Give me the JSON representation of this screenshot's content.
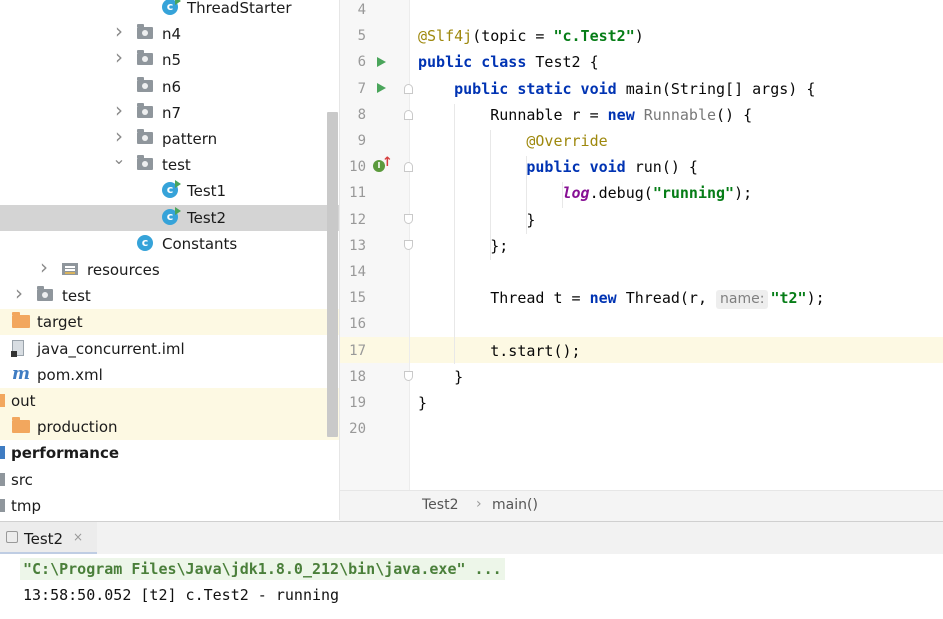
{
  "project_tree": [
    {
      "label": "ThreadStarter",
      "icon": "java-class-runnable-icon",
      "indent": 165,
      "chevron": "none",
      "style": "normal"
    },
    {
      "label": "n4",
      "icon": "package-folder-icon",
      "indent": 140,
      "chevron": "right",
      "style": "normal"
    },
    {
      "label": "n5",
      "icon": "package-folder-icon",
      "indent": 140,
      "chevron": "right",
      "style": "normal"
    },
    {
      "label": "n6",
      "icon": "package-folder-icon",
      "indent": 140,
      "chevron": "none",
      "style": "normal"
    },
    {
      "label": "n7",
      "icon": "package-folder-icon",
      "indent": 140,
      "chevron": "right",
      "style": "normal"
    },
    {
      "label": "pattern",
      "icon": "package-folder-icon",
      "indent": 140,
      "chevron": "right",
      "style": "normal"
    },
    {
      "label": "test",
      "icon": "package-folder-icon",
      "indent": 140,
      "chevron": "down",
      "style": "normal"
    },
    {
      "label": "Test1",
      "icon": "java-class-runnable-icon",
      "indent": 165,
      "chevron": "none",
      "style": "normal"
    },
    {
      "label": "Test2",
      "icon": "java-class-runnable-icon",
      "indent": 165,
      "chevron": "none",
      "style": "selected"
    },
    {
      "label": "Constants",
      "icon": "java-class-icon",
      "indent": 140,
      "chevron": "none",
      "style": "normal"
    },
    {
      "label": "resources",
      "icon": "resources-folder-icon",
      "indent": 65,
      "chevron": "right",
      "style": "normal"
    },
    {
      "label": "test",
      "icon": "folder-icon",
      "indent": 40,
      "chevron": "right",
      "style": "normal"
    },
    {
      "label": "target",
      "icon": "excluded-folder-icon",
      "indent": 15,
      "chevron": "none",
      "style": "excluded"
    },
    {
      "label": "java_concurrent.iml",
      "icon": "iml-file-icon",
      "indent": 15,
      "chevron": "none",
      "style": "normal"
    },
    {
      "label": "pom.xml",
      "icon": "maven-icon",
      "indent": 15,
      "chevron": "none",
      "style": "normal"
    },
    {
      "label": "out",
      "icon": "excluded-folder-icon",
      "indent": 11,
      "chevron": "none",
      "style": "excluded-root"
    },
    {
      "label": "production",
      "icon": "excluded-folder-icon",
      "indent": 15,
      "chevron": "none",
      "style": "excluded"
    },
    {
      "label": "performance",
      "icon": "module-icon",
      "indent": 11,
      "chevron": "none",
      "style": "bold"
    },
    {
      "label": "src",
      "icon": "module-icon",
      "indent": 11,
      "chevron": "none",
      "style": "normal"
    },
    {
      "label": "tmp",
      "icon": "module-icon",
      "indent": 11,
      "chevron": "none",
      "style": "normal"
    }
  ],
  "editor": {
    "line_numbers": [
      "4",
      "5",
      "6",
      "7",
      "8",
      "9",
      "10",
      "11",
      "12",
      "13",
      "14",
      "15",
      "16",
      "17",
      "18",
      "19",
      "20"
    ],
    "current_line": "17",
    "lines": [
      [],
      [
        {
          "t": "@Slf4j",
          "c": "ann"
        },
        {
          "t": "(topic = ",
          "c": ""
        },
        {
          "t": "\"c.Test2\"",
          "c": "str"
        },
        {
          "t": ")",
          "c": ""
        }
      ],
      [
        {
          "t": "public class ",
          "c": "kw"
        },
        {
          "t": "Test2 {",
          "c": ""
        }
      ],
      [
        {
          "t": "    public static void ",
          "c": "kw"
        },
        {
          "t": "main(String[] args) {",
          "c": ""
        }
      ],
      [
        {
          "t": "        Runnable r = ",
          "c": ""
        },
        {
          "t": "new ",
          "c": "kw"
        },
        {
          "t": "Runnable",
          "c": "grey"
        },
        {
          "t": "() {",
          "c": ""
        }
      ],
      [
        {
          "t": "            ",
          "c": ""
        },
        {
          "t": "@Override",
          "c": "ann"
        }
      ],
      [
        {
          "t": "            public void ",
          "c": "kw"
        },
        {
          "t": "run() {",
          "c": ""
        }
      ],
      [
        {
          "t": "                ",
          "c": ""
        },
        {
          "t": "log",
          "c": "logf"
        },
        {
          "t": ".debug(",
          "c": ""
        },
        {
          "t": "\"running\"",
          "c": "str"
        },
        {
          "t": ");",
          "c": ""
        }
      ],
      [
        {
          "t": "            }",
          "c": ""
        }
      ],
      [
        {
          "t": "        };",
          "c": ""
        }
      ],
      [],
      [
        {
          "t": "        Thread t = ",
          "c": ""
        },
        {
          "t": "new ",
          "c": "kw"
        },
        {
          "t": "Thread(r, ",
          "c": ""
        },
        {
          "t": "name:",
          "c": "hint"
        },
        {
          "t": "\"t2\"",
          "c": "str"
        },
        {
          "t": ");",
          "c": ""
        }
      ],
      [],
      [
        {
          "t": "        t.start();",
          "c": ""
        }
      ],
      [
        {
          "t": "    }",
          "c": ""
        }
      ],
      [
        {
          "t": "}",
          "c": ""
        }
      ],
      []
    ]
  },
  "breadcrumb": {
    "class": "Test2",
    "separator": "›",
    "method": "main()"
  },
  "run_panel": {
    "tab_label": "Test2",
    "tab_close": "×",
    "command": "\"C:\\Program Files\\Java\\jdk1.8.0_212\\bin\\java.exe\" ...",
    "output": "13:58:50.052 [t2] c.Test2 - running"
  },
  "colors": {
    "keyword": "#0033b3",
    "annotation": "#9e880d",
    "string": "#067d17",
    "log_field": "#871094",
    "current_line": "#fdf9e3",
    "selection": "#d4d4d4"
  }
}
